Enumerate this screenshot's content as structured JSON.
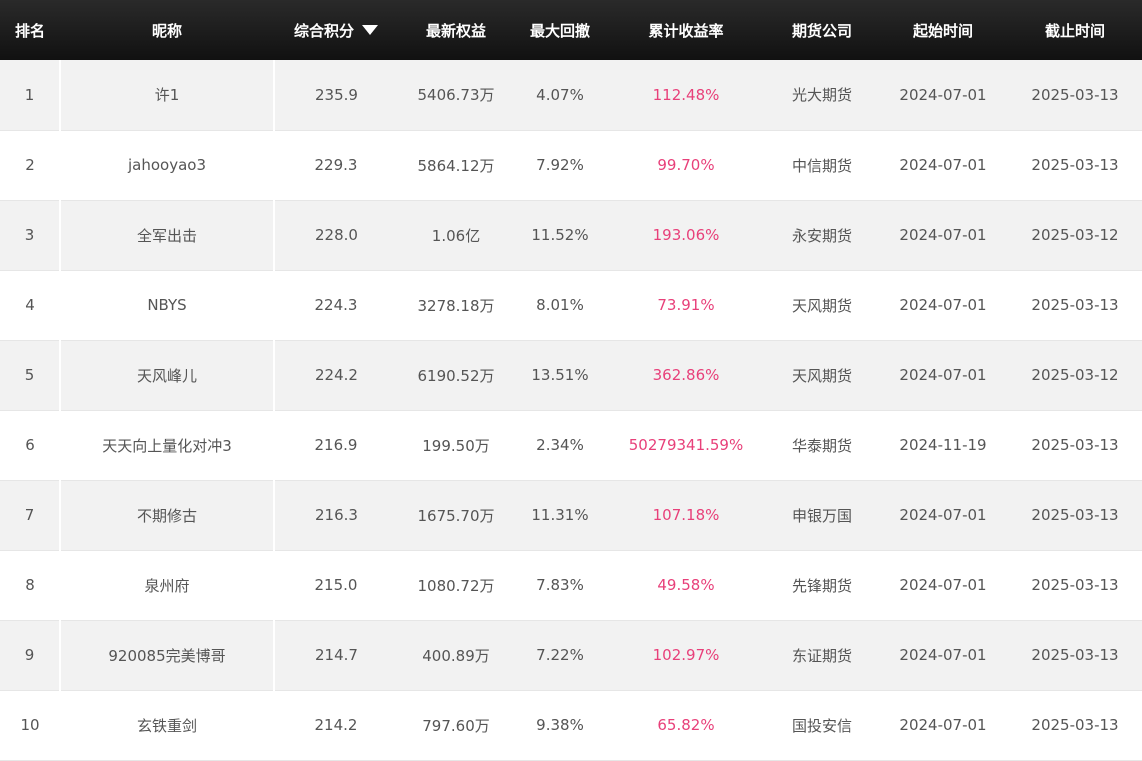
{
  "headers": {
    "rank": "排名",
    "nickname": "昵称",
    "score": "综合积分",
    "equity": "最新权益",
    "drawdown": "最大回撤",
    "cum_return": "累计收益率",
    "broker": "期货公司",
    "start": "起始时间",
    "end": "截止时间"
  },
  "sort_icon": "caret-down-icon",
  "accent_color": "#e8407a",
  "rows": [
    {
      "rank": "1",
      "nickname": "许1",
      "score": "235.9",
      "equity": "5406.73万",
      "drawdown": "4.07%",
      "cum_return": "112.48%",
      "broker": "光大期货",
      "start": "2024-07-01",
      "end": "2025-03-13"
    },
    {
      "rank": "2",
      "nickname": "jahooyao3",
      "score": "229.3",
      "equity": "5864.12万",
      "drawdown": "7.92%",
      "cum_return": "99.70%",
      "broker": "中信期货",
      "start": "2024-07-01",
      "end": "2025-03-13"
    },
    {
      "rank": "3",
      "nickname": "全军出击",
      "score": "228.0",
      "equity": "1.06亿",
      "drawdown": "11.52%",
      "cum_return": "193.06%",
      "broker": "永安期货",
      "start": "2024-07-01",
      "end": "2025-03-12"
    },
    {
      "rank": "4",
      "nickname": "NBYS",
      "score": "224.3",
      "equity": "3278.18万",
      "drawdown": "8.01%",
      "cum_return": "73.91%",
      "broker": "天风期货",
      "start": "2024-07-01",
      "end": "2025-03-13"
    },
    {
      "rank": "5",
      "nickname": "天风峰儿",
      "score": "224.2",
      "equity": "6190.52万",
      "drawdown": "13.51%",
      "cum_return": "362.86%",
      "broker": "天风期货",
      "start": "2024-07-01",
      "end": "2025-03-12"
    },
    {
      "rank": "6",
      "nickname": "天天向上量化对冲3",
      "score": "216.9",
      "equity": "199.50万",
      "drawdown": "2.34%",
      "cum_return": "50279341.59%",
      "broker": "华泰期货",
      "start": "2024-11-19",
      "end": "2025-03-13"
    },
    {
      "rank": "7",
      "nickname": "不期修古",
      "score": "216.3",
      "equity": "1675.70万",
      "drawdown": "11.31%",
      "cum_return": "107.18%",
      "broker": "申银万国",
      "start": "2024-07-01",
      "end": "2025-03-13"
    },
    {
      "rank": "8",
      "nickname": "泉州府",
      "score": "215.0",
      "equity": "1080.72万",
      "drawdown": "7.83%",
      "cum_return": "49.58%",
      "broker": "先锋期货",
      "start": "2024-07-01",
      "end": "2025-03-13"
    },
    {
      "rank": "9",
      "nickname": "920085完美博哥",
      "score": "214.7",
      "equity": "400.89万",
      "drawdown": "7.22%",
      "cum_return": "102.97%",
      "broker": "东证期货",
      "start": "2024-07-01",
      "end": "2025-03-13"
    },
    {
      "rank": "10",
      "nickname": "玄铁重剑",
      "score": "214.2",
      "equity": "797.60万",
      "drawdown": "9.38%",
      "cum_return": "65.82%",
      "broker": "国投安信",
      "start": "2024-07-01",
      "end": "2025-03-13"
    }
  ]
}
